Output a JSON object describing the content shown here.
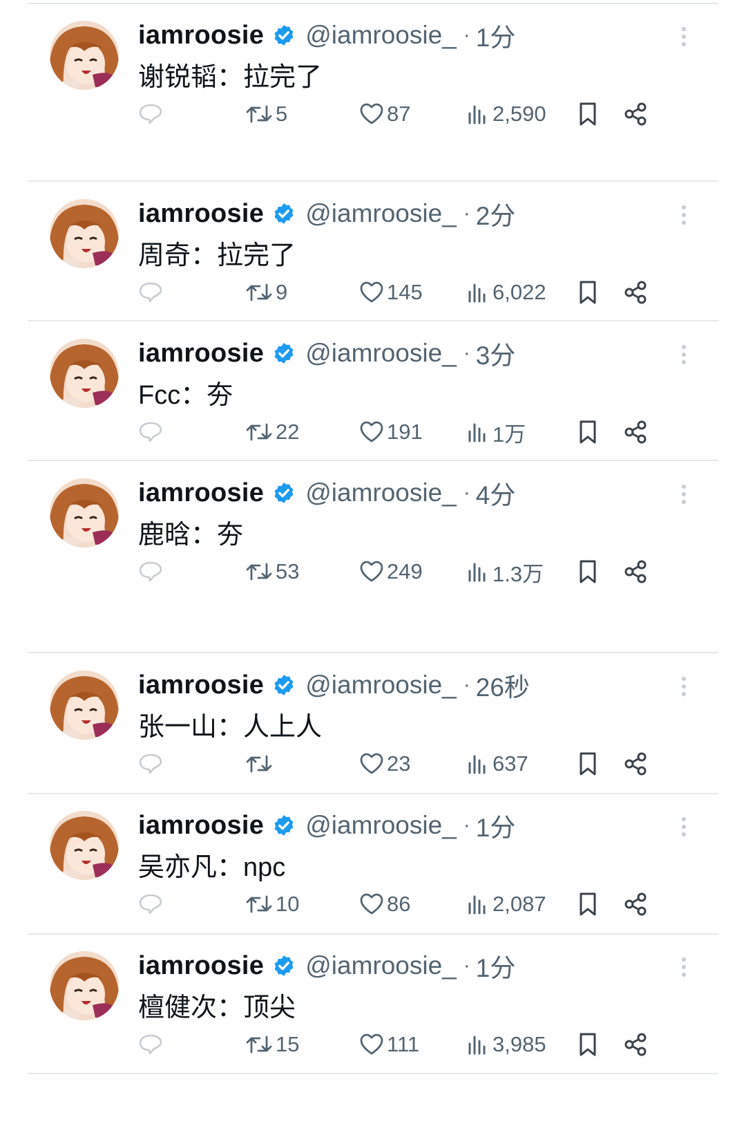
{
  "colors": {
    "accent": "#1d9bf0",
    "text": "#0f1419",
    "secondary": "#536471",
    "divider": "#e6e9ec",
    "icon_light": "#c7ccd1"
  },
  "icons": [
    "reply-icon",
    "retweet-icon",
    "like-icon",
    "views-icon",
    "bookmark-icon",
    "share-icon",
    "more-icon",
    "verified-icon"
  ],
  "tweets": [
    {
      "name": "iamroosie",
      "handle": "@iamroosie_",
      "dot": "·",
      "time": "1分",
      "text": "谢锐韬：拉完了",
      "retweets": "5",
      "likes": "87",
      "views": "2,590"
    },
    {
      "name": "iamroosie",
      "handle": "@iamroosie_",
      "dot": "·",
      "time": "2分",
      "text": "周奇：拉完了",
      "retweets": "9",
      "likes": "145",
      "views": "6,022"
    },
    {
      "name": "iamroosie",
      "handle": "@iamroosie_",
      "dot": "·",
      "time": "3分",
      "text": "Fcc：夯",
      "retweets": "22",
      "likes": "191",
      "views": "1万"
    },
    {
      "name": "iamroosie",
      "handle": "@iamroosie_",
      "dot": "·",
      "time": "4分",
      "text": "鹿晗：夯",
      "retweets": "53",
      "likes": "249",
      "views": "1.3万"
    },
    {
      "name": "iamroosie",
      "handle": "@iamroosie_",
      "dot": "·",
      "time": "26秒",
      "text": "张一山：人上人",
      "retweets": "",
      "likes": "23",
      "views": "637"
    },
    {
      "name": "iamroosie",
      "handle": "@iamroosie_",
      "dot": "·",
      "time": "1分",
      "text": "吴亦凡：npc",
      "retweets": "10",
      "likes": "86",
      "views": "2,087"
    },
    {
      "name": "iamroosie",
      "handle": "@iamroosie_",
      "dot": "·",
      "time": "1分",
      "text": "檀健次：顶尖",
      "retweets": "15",
      "likes": "111",
      "views": "3,985"
    }
  ]
}
